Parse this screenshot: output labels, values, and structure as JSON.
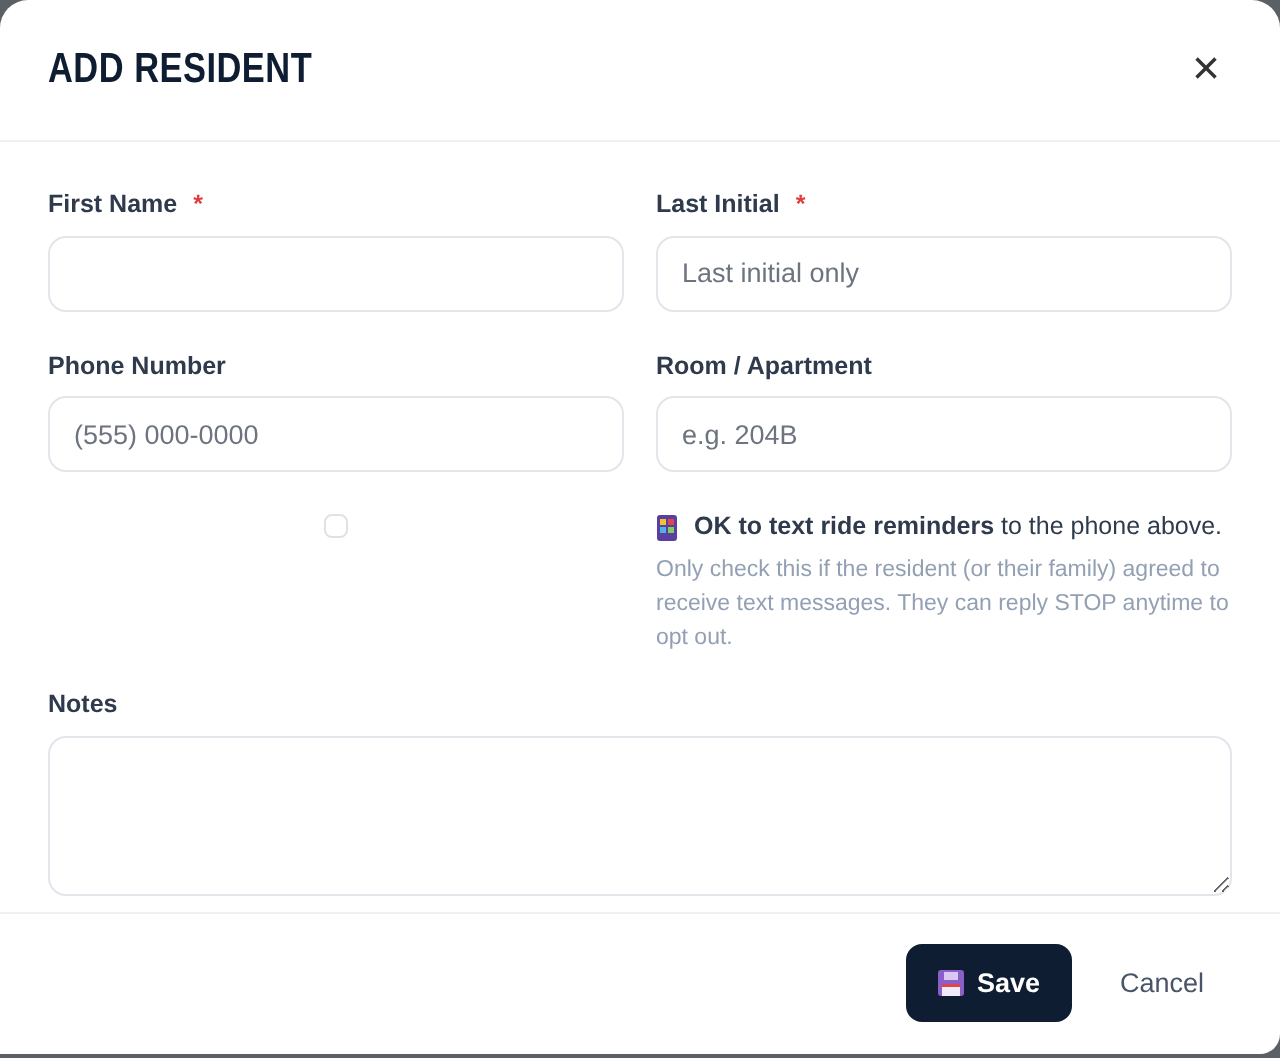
{
  "dialog": {
    "title": "ADD RESIDENT",
    "close": "×"
  },
  "fields": [
    {
      "label": "First Name",
      "required_mark": "*",
      "kind": "input"
    },
    {
      "label": "Last Initial",
      "required_mark": "*",
      "placeholder": "Last initial only",
      "kind": "input"
    },
    {
      "label": "Phone Number",
      "placeholder": "(555) 000-0000",
      "kind": "input"
    },
    {
      "label": "Room / Apartment",
      "placeholder": "e.g. 204B",
      "kind": "input"
    }
  ],
  "consent": {
    "checked": false,
    "text": "**OK to text ride reminders** to the phone above.",
    "help": "Only check this if the resident (or their family) agreed to receive text messages. They can reply STOP anytime to opt out."
  },
  "notes": {
    "label": "Notes"
  },
  "buttons": [
    {
      "label": "Save",
      "kind": "primary"
    },
    {
      "label": "Cancel",
      "kind": "secondary"
    }
  ]
}
